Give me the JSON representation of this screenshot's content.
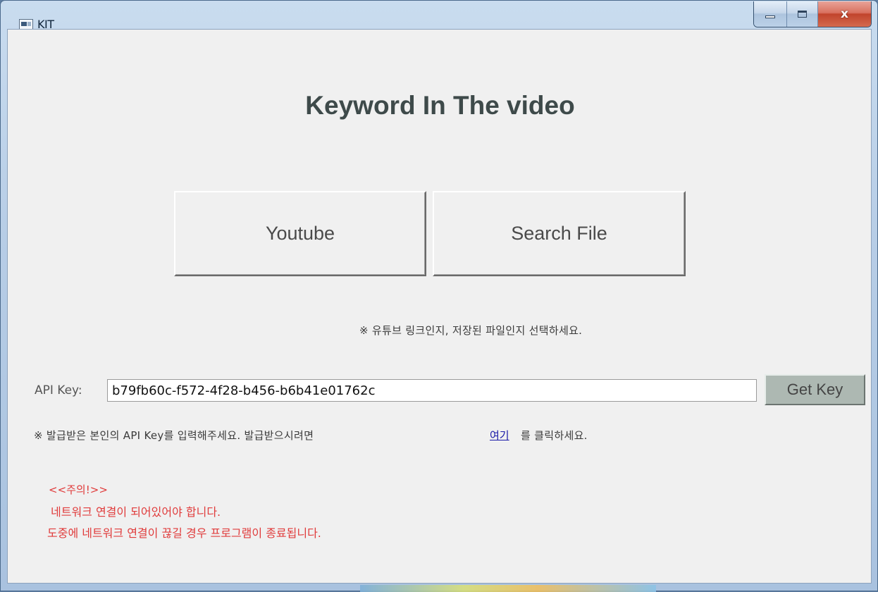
{
  "window": {
    "title": "KIT",
    "close_glyph": "x"
  },
  "main": {
    "heading": "Keyword In The video",
    "buttons": {
      "youtube": "Youtube",
      "search_file": "Search File"
    },
    "select_hint": "※ 유튜브 링크인지, 저장된 파일인지 선택하세요.",
    "api": {
      "label": "API Key:",
      "value": "b79fb60c-f572-4f28-b456-b6b41e01762c",
      "get_key": "Get Key"
    },
    "api_hint_before": "※ 발급받은 본인의 API Key를 입력해주세요. 발급받으시려면",
    "api_hint_link": "여기",
    "api_hint_after": "를 클릭하세요.",
    "warning": {
      "title": "<<주의!>>",
      "line1": "네트워크 연결이 되어있어야 합니다.",
      "line2": "도중에 네트워크 연결이 끊길 경우 프로그램이 종료됩니다."
    }
  }
}
